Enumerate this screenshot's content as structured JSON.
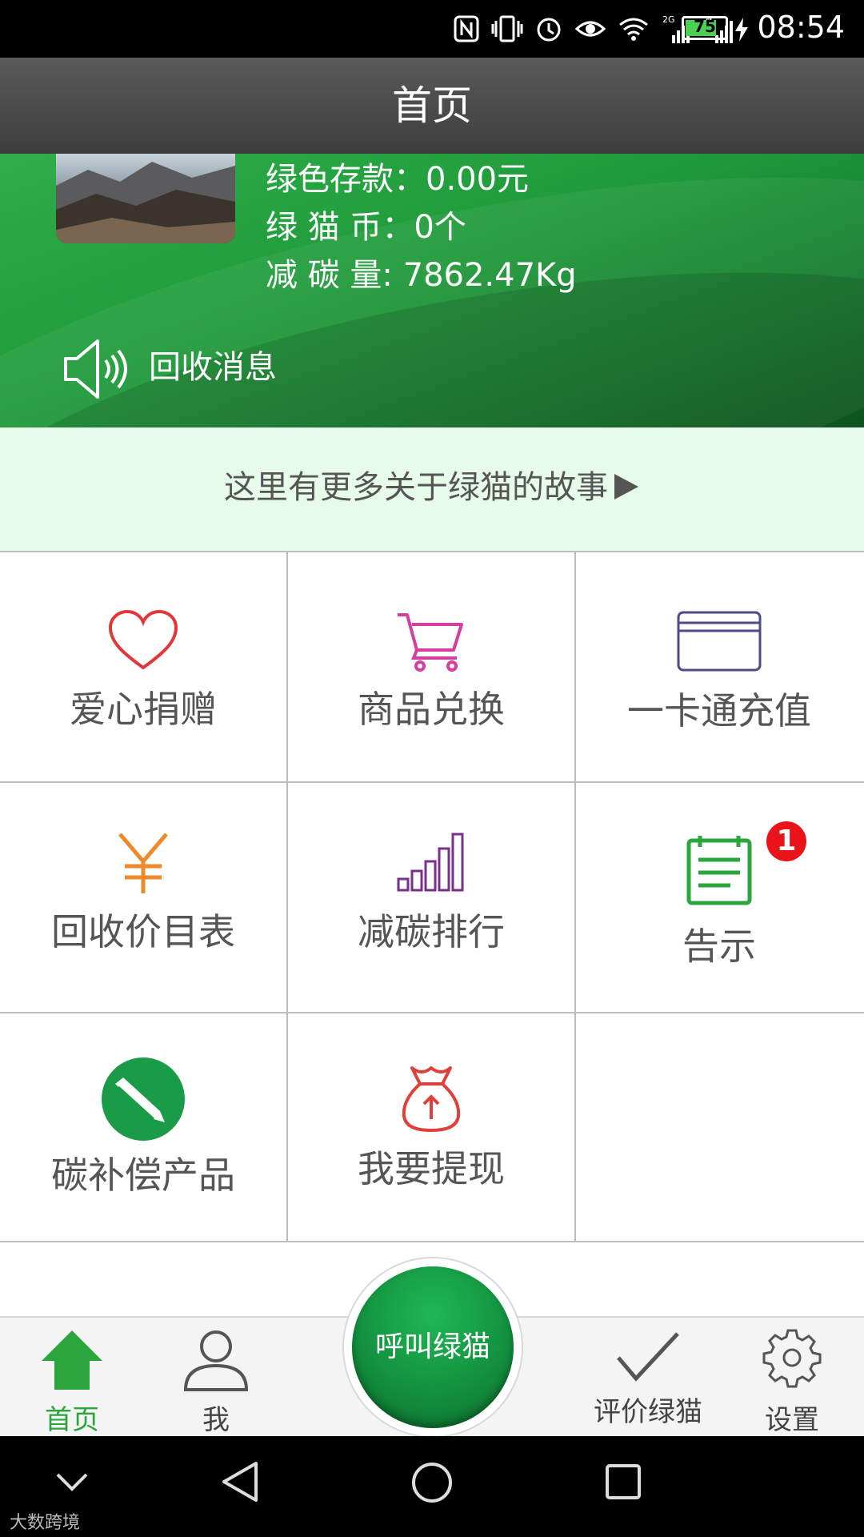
{
  "status_bar": {
    "time": "08:54",
    "battery": "75",
    "battery_level": 0.75,
    "network": "2G",
    "network2": "H"
  },
  "header": {
    "title": "首页"
  },
  "account": {
    "deposit": "绿色存款：0.00元",
    "coins": "绿 猫 币：0个",
    "carbon": "减 碳 量: 7862.47Kg",
    "message_label": "回收消息"
  },
  "story_link": "这里有更多关于绿猫的故事",
  "grid": {
    "donate": "爱心捐赠",
    "exchange": "商品兑换",
    "card_recharge": "一卡通充值",
    "price_list": "回收价目表",
    "carbon_rank": "减碳排行",
    "notice": "告示",
    "notice_badge": "1",
    "carbon_offset": "碳补偿产品",
    "withdraw": "我要提现"
  },
  "tabbar": {
    "home": "首页",
    "me": "我",
    "call": "呼叫绿猫",
    "rate": "评价绿猫",
    "settings": "设置"
  },
  "colors": {
    "green": "#1f9a3a",
    "tab_active": "#2aa63d",
    "badge": "#e8141a"
  },
  "watermark": "大数跨境"
}
